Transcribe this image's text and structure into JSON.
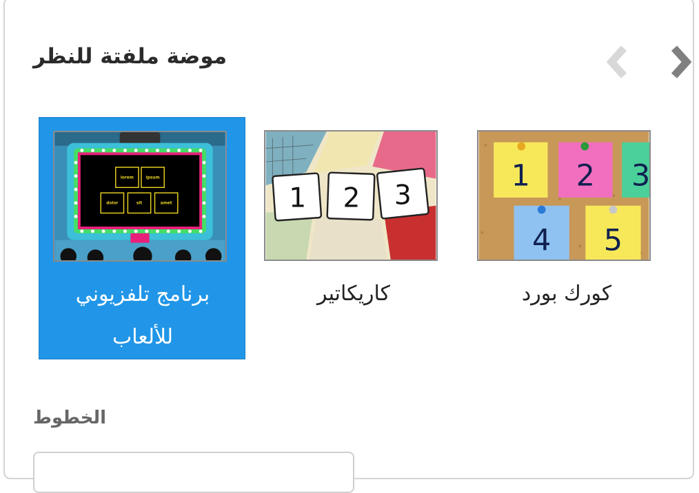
{
  "header": {
    "title": "موضة ملفتة للنظر",
    "prev_icon": "chevron-left-icon",
    "next_icon": "chevron-right-icon"
  },
  "themes": [
    {
      "label": "برنامج تلفزيوني للألعاب",
      "selected": true,
      "icon": "game-show-thumbnail",
      "words": [
        "lorem",
        "ipsum",
        "dolor",
        "sit",
        "amet"
      ]
    },
    {
      "label": "كاريكاتير",
      "selected": false,
      "icon": "comic-thumbnail",
      "numbers": [
        "1",
        "2",
        "3"
      ]
    },
    {
      "label": "كورك بورد",
      "selected": false,
      "icon": "corkboard-thumbnail",
      "numbers": [
        "1",
        "2",
        "3",
        "4",
        "5"
      ]
    }
  ],
  "fonts": {
    "heading": "الخطوط"
  },
  "colors": {
    "selected_bg": "#2196e8",
    "title_text": "#2b2b2b",
    "arrow_dark": "#808080",
    "arrow_light": "#d8d8d8"
  }
}
